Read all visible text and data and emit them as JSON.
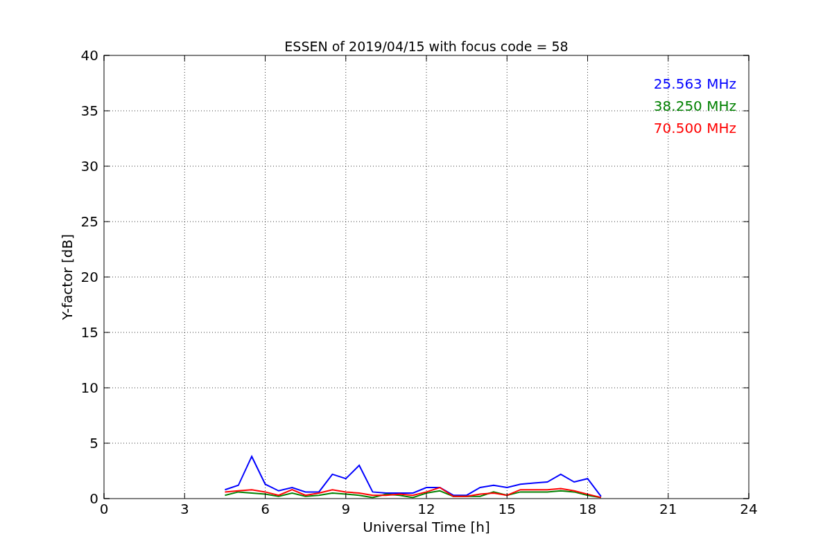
{
  "chart": {
    "chart_data": {
      "type": "line",
      "title": "ESSEN of 2019/04/15 with focus code = 58",
      "xlabel": "Universal Time [h]",
      "ylabel": "Y-factor [dB]",
      "x": [
        4.5,
        5,
        5.5,
        6,
        6.5,
        7,
        7.5,
        8,
        8.5,
        9,
        9.5,
        10,
        10.5,
        11,
        11.5,
        12,
        12.5,
        13,
        13.5,
        14,
        14.5,
        15,
        15.5,
        16,
        16.5,
        17,
        17.5,
        18,
        18.5
      ],
      "series": [
        {
          "name": "25.563 MHz",
          "color": "#0000ff",
          "values": [
            0.8,
            1.2,
            3.8,
            1.3,
            0.7,
            1.0,
            0.6,
            0.6,
            2.2,
            1.8,
            3.0,
            0.6,
            0.5,
            0.5,
            0.5,
            1.0,
            1.0,
            0.3,
            0.3,
            1.0,
            1.2,
            1.0,
            1.3,
            1.4,
            1.5,
            2.2,
            1.5,
            1.8,
            0.2
          ]
        },
        {
          "name": "38.250 MHz",
          "color": "#008000",
          "values": [
            0.3,
            0.6,
            0.5,
            0.4,
            0.2,
            0.5,
            0.2,
            0.3,
            0.5,
            0.4,
            0.3,
            0.1,
            0.4,
            0.3,
            0.1,
            0.5,
            0.7,
            0.2,
            0.2,
            0.2,
            0.6,
            0.3,
            0.6,
            0.6,
            0.6,
            0.7,
            0.6,
            0.3,
            0.1
          ]
        },
        {
          "name": "70.500 MHz",
          "color": "#ff0000",
          "values": [
            0.6,
            0.7,
            0.8,
            0.6,
            0.3,
            0.8,
            0.3,
            0.5,
            0.8,
            0.6,
            0.5,
            0.3,
            0.3,
            0.4,
            0.3,
            0.6,
            1.0,
            0.2,
            0.2,
            0.4,
            0.5,
            0.3,
            0.8,
            0.8,
            0.8,
            0.9,
            0.7,
            0.4,
            0.1
          ]
        }
      ],
      "xlim": [
        0,
        24
      ],
      "ylim": [
        0,
        40
      ],
      "xticks": [
        0,
        3,
        6,
        9,
        12,
        15,
        18,
        21,
        24
      ],
      "yticks": [
        0,
        5,
        10,
        15,
        20,
        25,
        30,
        35,
        40
      ],
      "grid": true
    }
  }
}
